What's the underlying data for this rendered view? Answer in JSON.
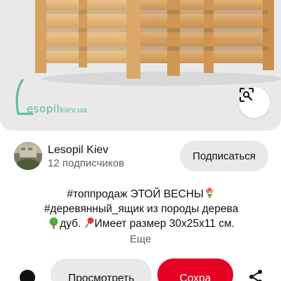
{
  "hero": {
    "logo_text": "esopil",
    "logo_domain": "kiev.ua",
    "lens_icon": "visual-search-icon"
  },
  "author": {
    "name": "Lesopil Kiev",
    "subscribers": "12 подписчиков",
    "subscribe_label": "Подписаться"
  },
  "description": {
    "line1": "#топпродаж ЭТОЙ ВЕСНЫ",
    "line2": "#деревянный_ящик из породы дерева",
    "line3_pre": "дуб. ",
    "line3_post": "Имеет размер 30x25x11 см.",
    "more_label": "Еще"
  },
  "actions": {
    "view_label": "Просмотреть",
    "save_label": "Сохра",
    "share_icon": "share-icon"
  },
  "colors": {
    "save_red": "#e60023",
    "button_gray": "#e9e9e9",
    "logo_teal": "#5fb8a3",
    "wood": "#e3b47a"
  }
}
